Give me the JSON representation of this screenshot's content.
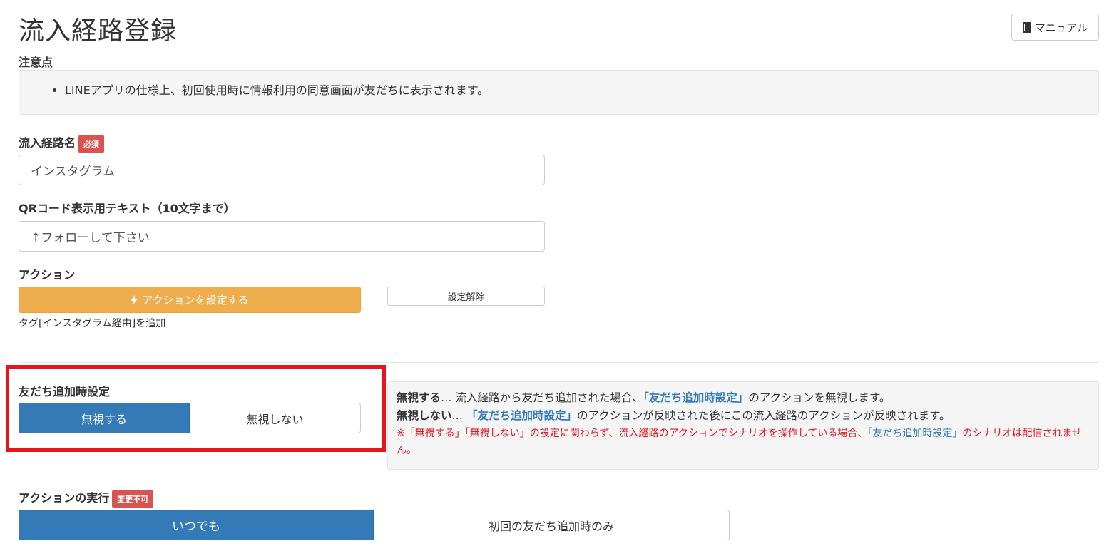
{
  "page": {
    "title": "流入経路登録",
    "manual_label": "マニュアル"
  },
  "notes": {
    "heading": "注意点",
    "items": [
      "LINEアプリの仕様上、初回使用時に情報利用の同意画面が友だちに表示されます。"
    ]
  },
  "route_name": {
    "label": "流入経路名",
    "badge": "必須",
    "value": "インスタグラム"
  },
  "qr_text": {
    "label": "QRコード表示用テキスト（10文字まで）",
    "value": "↑フォローして下さい"
  },
  "action": {
    "label": "アクション",
    "set_button": "アクションを設定する",
    "clear_button": "設定解除",
    "summary": "タグ[インスタグラム経由]を追加"
  },
  "friend_add": {
    "label": "友だち追加時設定",
    "options": [
      "無視する",
      "無視しない"
    ],
    "selected": "無視する",
    "info": {
      "ignore_term": "無視する",
      "ignore_ellipsis": "…",
      "ignore_text_1": " 流入経路から友だち追加された場合、",
      "ignore_link": "「友だち追加時設定」",
      "ignore_text_2": "のアクションを無視します。",
      "no_ignore_term": "無視しない",
      "no_ignore_ellipsis": "…",
      "no_ignore_text_1": " ",
      "no_ignore_link": "「友だち追加時設定」",
      "no_ignore_text_2": "のアクションが反映された後にこの流入経路のアクションが反映されます。",
      "warning_1": "※「無視する」「無視しない」の設定に関わらず、流入経路のアクションでシナリオを操作している場合、",
      "warning_link": "「友だち追加時設定」",
      "warning_2": "のシナリオは配信されません。"
    }
  },
  "execution": {
    "label": "アクションの実行",
    "badge": "変更不可",
    "options": [
      "いつでも",
      "初回の友だち追加時のみ"
    ],
    "selected": "いつでも"
  },
  "colors": {
    "primary": "#337ab7",
    "warning_button": "#f0ad4e",
    "danger_badge": "#d9534f",
    "highlight_frame": "#e5141e",
    "warning_text": "#e5141e"
  }
}
